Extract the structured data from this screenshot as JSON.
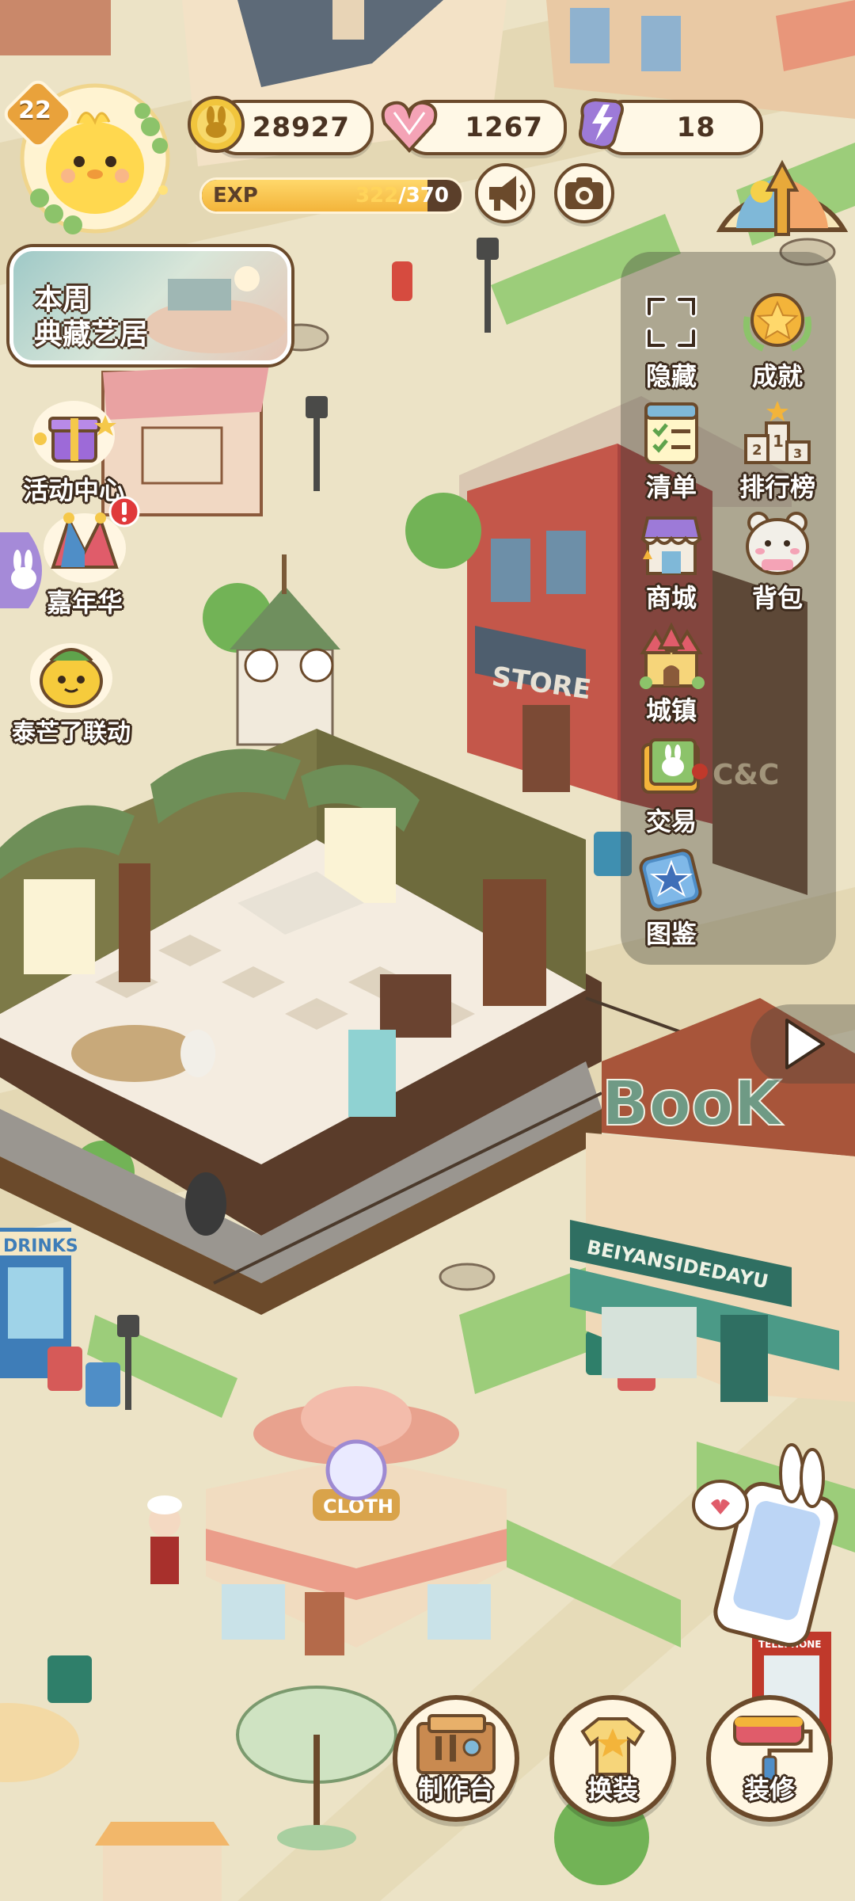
{
  "hud": {
    "level": "22",
    "coins": "28927",
    "hearts": "1267",
    "energy": "18",
    "exp": {
      "label": "EXP",
      "current": "322",
      "max": "/370",
      "fraction": 0.87
    }
  },
  "left_events": {
    "weekly": "本周\n典藏艺居",
    "items": [
      "活动中心",
      "嘉年华",
      "泰芒了联动"
    ]
  },
  "right_menu": {
    "items": [
      "隐藏",
      "成就",
      "清单",
      "排行榜",
      "商城",
      "背包",
      "城镇",
      "交易",
      "图鉴"
    ]
  },
  "bottom_actions": [
    "制作台",
    "换装",
    "装修"
  ],
  "scene_signs": {
    "store": "STORE",
    "book": "BooK",
    "bookstore_name": "BEIYANSIDEDAYU",
    "drinks": "DRINKS",
    "cloth": "CLOTH",
    "cafe": "C&C",
    "telephone": "TELEPHONE"
  },
  "colors": {
    "outline": "#6b4a2b",
    "panel": "#fff8e6",
    "gold": "#f3b43a"
  }
}
